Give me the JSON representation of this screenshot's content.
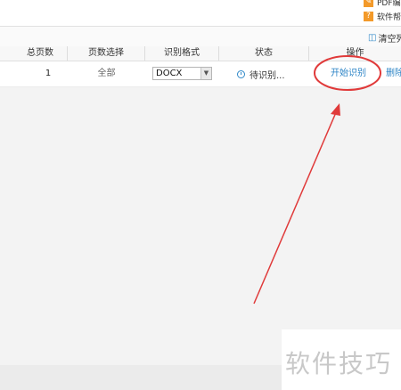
{
  "side_links": [
    {
      "label": "PDF编辑",
      "icon": "edit-icon"
    },
    {
      "label": "软件帮助",
      "icon": "help-icon"
    }
  ],
  "toolbar": {
    "clear_label": "清空列表",
    "clear_icon": "trash-icon"
  },
  "table": {
    "headers": [
      "总页数",
      "页数选择",
      "识别格式",
      "状态",
      "操作"
    ],
    "rows": [
      {
        "total_pages": "1",
        "page_selection": "全部",
        "format": "DOCX",
        "status": "待识别...",
        "action_start": "开始识别",
        "action_delete": "删除"
      }
    ]
  },
  "watermark": "软件技巧",
  "colors": {
    "link": "#2c84c6",
    "annotation": "#e03a3a",
    "icon_orange": "#f39a2a"
  }
}
